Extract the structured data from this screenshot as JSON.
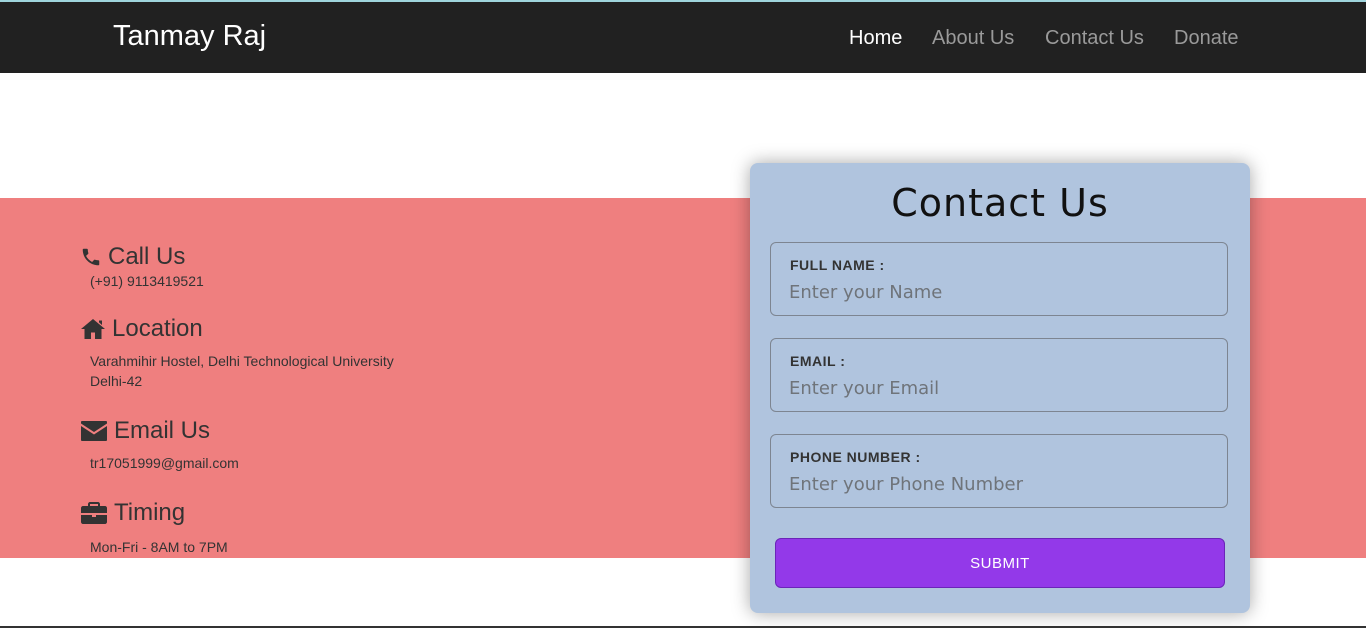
{
  "navbar": {
    "brand": "Tanmay Raj",
    "links": [
      {
        "label": "Home",
        "active": true
      },
      {
        "label": "About Us",
        "active": false
      },
      {
        "label": "Contact Us",
        "active": false
      },
      {
        "label": "Donate",
        "active": false
      }
    ]
  },
  "info": {
    "call": {
      "title": "Call Us",
      "icon": "phone-icon",
      "lines": [
        "(+91) 9113419521"
      ]
    },
    "location": {
      "title": "Location",
      "icon": "home-icon",
      "lines": [
        "Varahmihir Hostel, Delhi Technological University",
        "Delhi-42"
      ]
    },
    "email": {
      "title": "Email Us",
      "icon": "envelope-icon",
      "lines": [
        "tr17051999@gmail.com"
      ]
    },
    "timing": {
      "title": "Timing",
      "icon": "briefcase-icon",
      "lines": [
        "Mon-Fri - 8AM to 7PM"
      ]
    }
  },
  "form": {
    "title": "Contact Us",
    "fields": [
      {
        "label": "FULL NAME :",
        "placeholder": "Enter your Name",
        "value": ""
      },
      {
        "label": "EMAIL :",
        "placeholder": "Enter your Email",
        "value": ""
      },
      {
        "label": "PHONE NUMBER :",
        "placeholder": "Enter your Phone Number",
        "value": ""
      }
    ],
    "submit_label": "SUBMIT"
  },
  "colors": {
    "navbar": "#212121",
    "band": "#ef7f7f",
    "card": "#b0c4de",
    "submit": "#9339e9"
  }
}
